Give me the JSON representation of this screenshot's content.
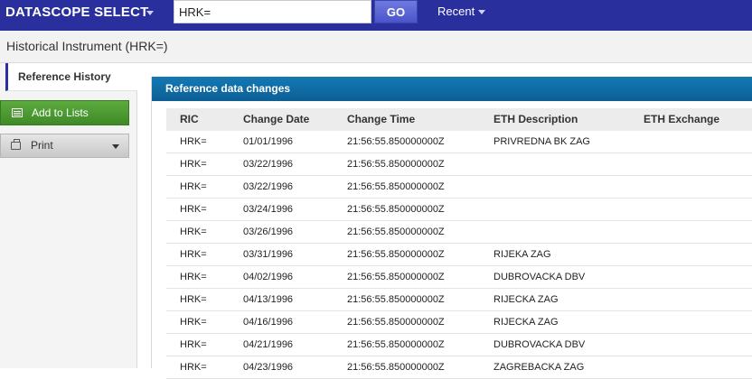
{
  "app": {
    "title": "DATASCOPE SELECT"
  },
  "search": {
    "value": "HRK=",
    "go_label": "GO"
  },
  "nav": {
    "recent_label": "Recent"
  },
  "page": {
    "title": "Historical Instrument (HRK=)"
  },
  "sidebar": {
    "tab_label": "Reference History",
    "add_to_lists_label": "Add to Lists",
    "print_label": "Print"
  },
  "panel": {
    "title": "Reference data changes",
    "columns": [
      "RIC",
      "Change Date",
      "Change Time",
      "ETH Description",
      "ETH Exchange"
    ],
    "rows": [
      {
        "ric": "HRK=",
        "date": "01/01/1996",
        "time": "21:56:55.850000000Z",
        "desc": "PRIVREDNA BK ZAG",
        "exch": ""
      },
      {
        "ric": "HRK=",
        "date": "03/22/1996",
        "time": "21:56:55.850000000Z",
        "desc": "",
        "exch": ""
      },
      {
        "ric": "HRK=",
        "date": "03/22/1996",
        "time": "21:56:55.850000000Z",
        "desc": "",
        "exch": ""
      },
      {
        "ric": "HRK=",
        "date": "03/24/1996",
        "time": "21:56:55.850000000Z",
        "desc": "",
        "exch": ""
      },
      {
        "ric": "HRK=",
        "date": "03/26/1996",
        "time": "21:56:55.850000000Z",
        "desc": "",
        "exch": ""
      },
      {
        "ric": "HRK=",
        "date": "03/31/1996",
        "time": "21:56:55.850000000Z",
        "desc": "RIJEKA ZAG",
        "exch": ""
      },
      {
        "ric": "HRK=",
        "date": "04/02/1996",
        "time": "21:56:55.850000000Z",
        "desc": "DUBROVACKA DBV",
        "exch": ""
      },
      {
        "ric": "HRK=",
        "date": "04/13/1996",
        "time": "21:56:55.850000000Z",
        "desc": "RIJECKA ZAG",
        "exch": ""
      },
      {
        "ric": "HRK=",
        "date": "04/16/1996",
        "time": "21:56:55.850000000Z",
        "desc": "RIJECKA ZAG",
        "exch": ""
      },
      {
        "ric": "HRK=",
        "date": "04/21/1996",
        "time": "21:56:55.850000000Z",
        "desc": "DUBROVACKA DBV",
        "exch": ""
      },
      {
        "ric": "HRK=",
        "date": "04/23/1996",
        "time": "21:56:55.850000000Z",
        "desc": "ZAGREBACKA ZAG",
        "exch": ""
      }
    ]
  },
  "colors": {
    "topbar": "#2a2f9e",
    "panel_header": "#1479b4",
    "add_button": "#4e9b33"
  },
  "icons": {
    "add_to_lists": "list-icon",
    "print": "printer-icon"
  }
}
